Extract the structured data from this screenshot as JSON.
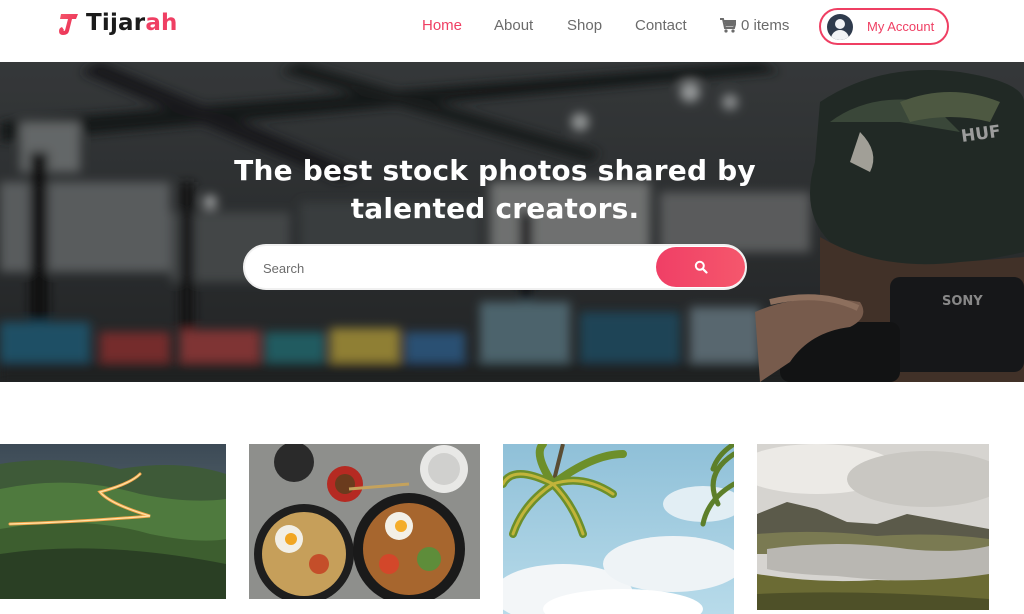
{
  "brand": {
    "name_main": "Tijar",
    "name_accent": "ah",
    "accent_color": "#ef3f63"
  },
  "nav": {
    "items": [
      {
        "label": "Home",
        "active": true
      },
      {
        "label": "About",
        "active": false
      },
      {
        "label": "Shop",
        "active": false
      },
      {
        "label": "Contact",
        "active": false
      }
    ],
    "cart_label": "0 items",
    "account_label": "My Account"
  },
  "hero": {
    "title_line1": "The best stock photos shared by",
    "title_line2": "talented creators.",
    "search_placeholder": "Search"
  },
  "gallery": {
    "photos": [
      {
        "subject": "winding-road-hills"
      },
      {
        "subject": "breakfast-plates"
      },
      {
        "subject": "palm-trees-sky"
      },
      {
        "subject": "mountain-lake"
      }
    ]
  },
  "icons": {
    "logo": "tijarah-logo-icon",
    "cart": "cart-icon",
    "avatar": "user-avatar-icon",
    "search": "search-icon"
  }
}
